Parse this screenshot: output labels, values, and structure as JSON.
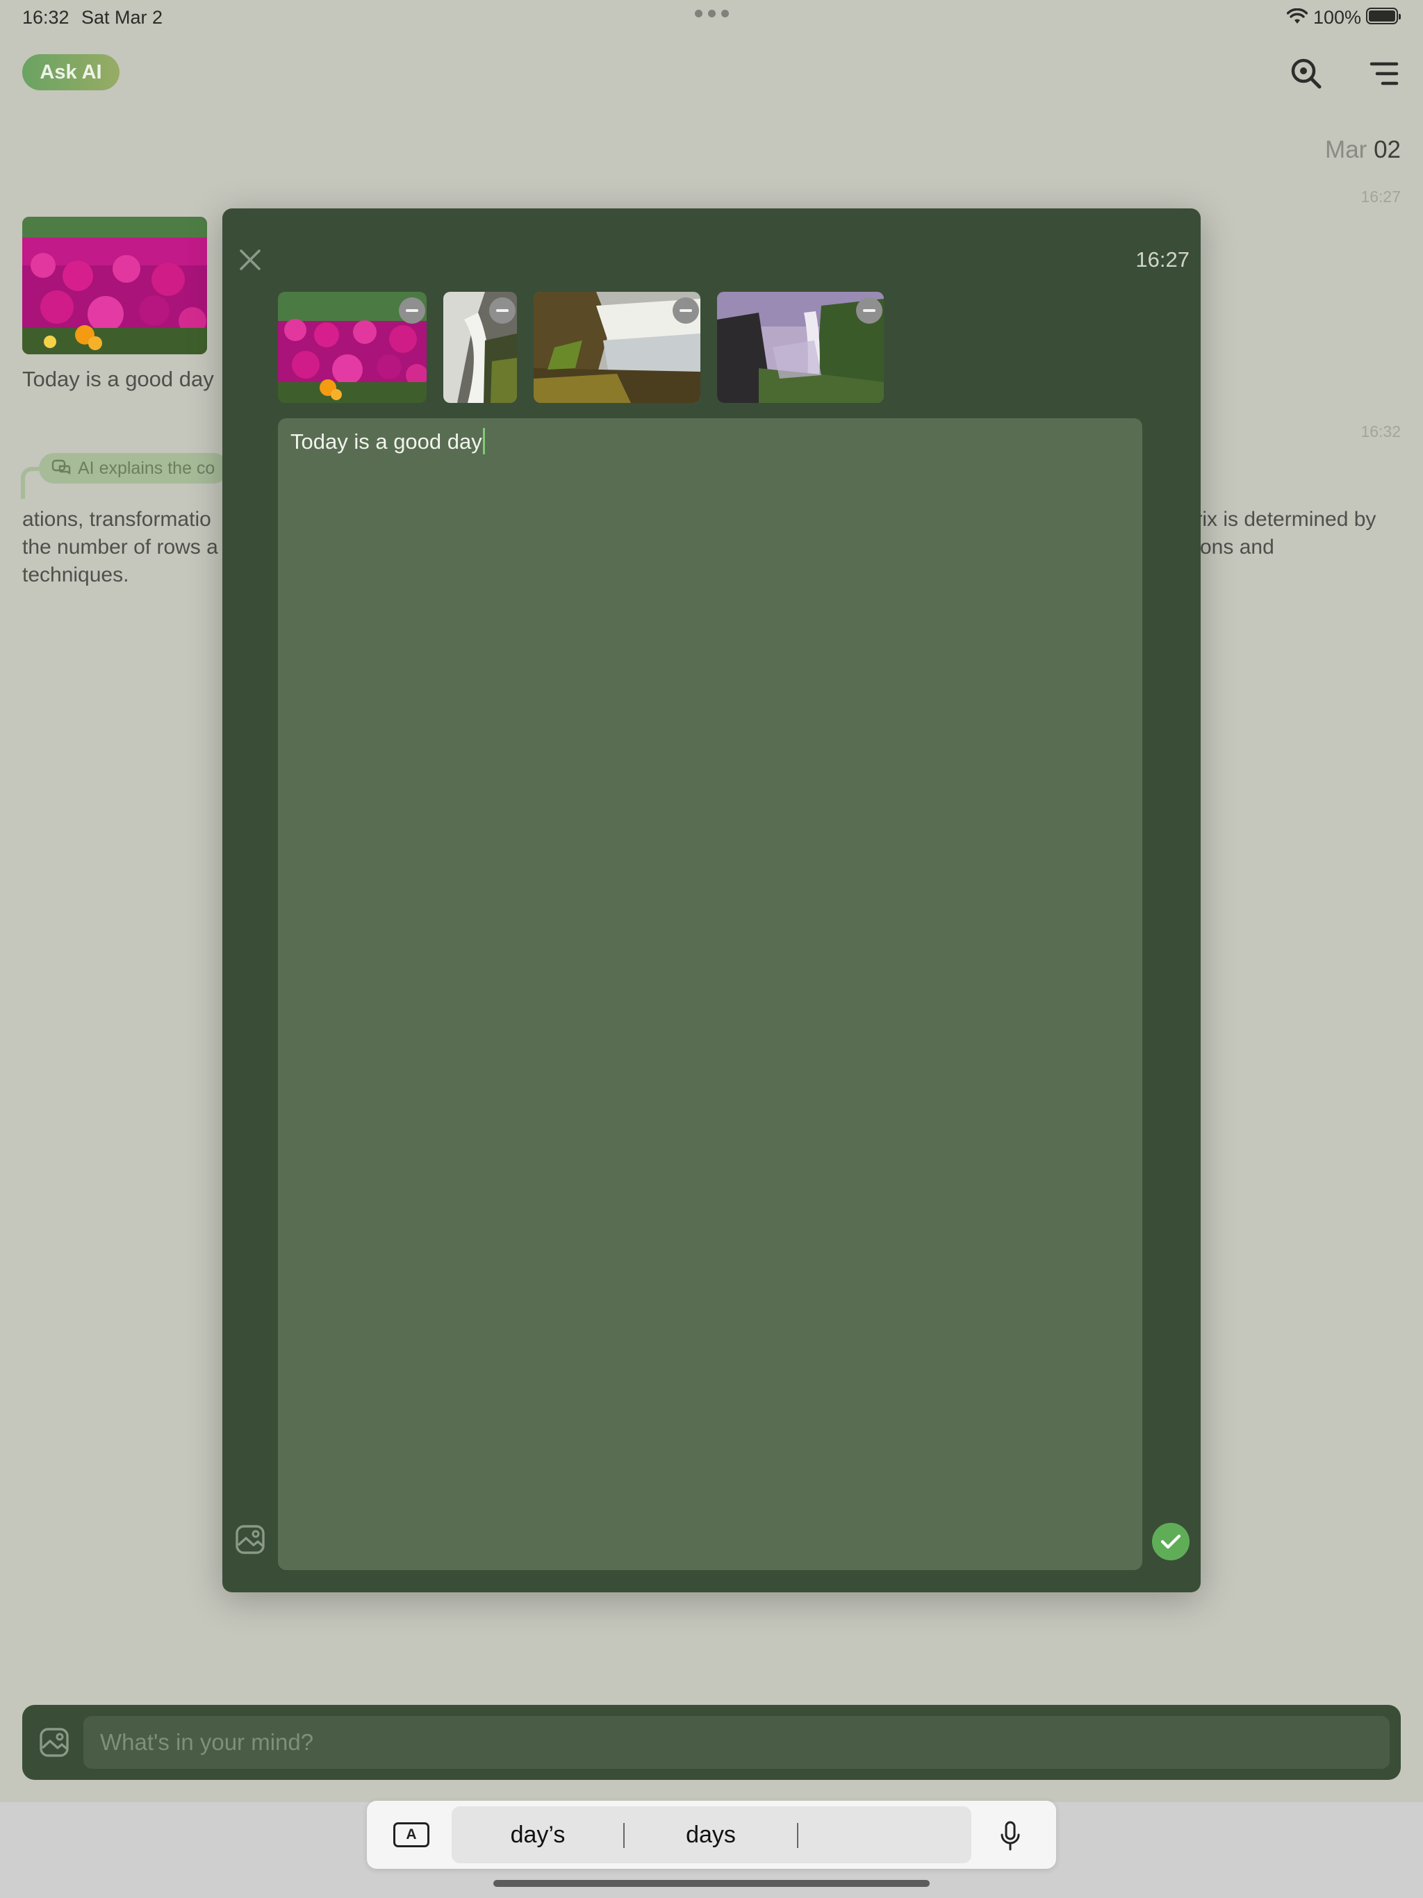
{
  "status_bar": {
    "time": "16:32",
    "date": "Sat Mar 2",
    "battery": "100%"
  },
  "header": {
    "ask_ai_label": "Ask AI",
    "search_icon": "search-icon",
    "menu_icon": "menu-icon"
  },
  "feed": {
    "date_month": "Mar",
    "date_day": "02",
    "entries": [
      {
        "time": "16:27",
        "text": "Today is a good day"
      },
      {
        "time": "16:32",
        "ai_label": "AI explains the co",
        "line1_left": "ations, transformatio",
        "line1_right": "trix is determined by",
        "line2_left": "the number of rows a",
        "line2_right": "tions and",
        "line3_left": "techniques."
      }
    ]
  },
  "editor": {
    "time": "16:27",
    "text": "Today is a good day",
    "images": [
      {
        "name": "flowers",
        "remove_icon": "minus-icon"
      },
      {
        "name": "waterfall-closeup",
        "remove_icon": "minus-icon"
      },
      {
        "name": "waterfall-wide",
        "remove_icon": "minus-icon"
      },
      {
        "name": "waterfall-cliff",
        "remove_icon": "minus-icon"
      }
    ]
  },
  "composer": {
    "placeholder": "What's in your mind?"
  },
  "keyboard": {
    "suggestions": [
      "day’s",
      "days",
      ""
    ],
    "format_key": "A"
  },
  "colors": {
    "modal_bg": "#3a4d37",
    "editor_bg": "#586d52",
    "accent_green": "#5fae57",
    "page_bg": "#c5c6bc"
  }
}
